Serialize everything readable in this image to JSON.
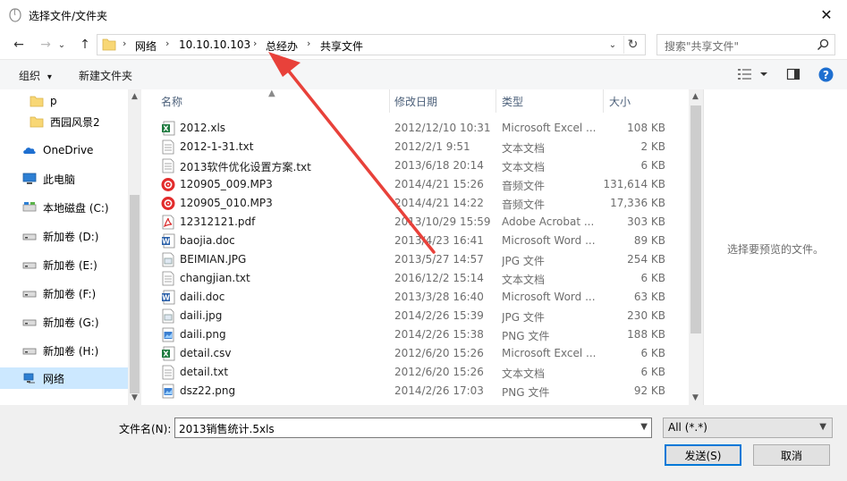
{
  "window": {
    "title": "选择文件/文件夹",
    "close_glyph": "✕"
  },
  "nav": {
    "back_glyph": "←",
    "forward_glyph": "→",
    "recent_glyph": "⌄",
    "up_glyph": "↑",
    "breadcrumbs": [
      "网络",
      "10.10.10.103",
      "总经办",
      "共享文件"
    ],
    "separator": "›",
    "refresh_glyph": "↻",
    "dropdown_glyph": "⌄"
  },
  "search": {
    "placeholder": "搜索\"共享文件\""
  },
  "toolbar": {
    "organize": "组织",
    "new_folder": "新建文件夹",
    "dropdown_glyph": "▾"
  },
  "sidebar": {
    "items": [
      {
        "label": "p",
        "icon": "folder-icon"
      },
      {
        "label": "西园风景2",
        "icon": "folder-icon"
      },
      {
        "label": "OneDrive",
        "icon": "cloud-icon"
      },
      {
        "label": "此电脑",
        "icon": "computer-icon"
      },
      {
        "label": "本地磁盘 (C:)",
        "icon": "drive-icon"
      },
      {
        "label": "新加卷 (D:)",
        "icon": "drive-icon"
      },
      {
        "label": "新加卷 (E:)",
        "icon": "drive-icon"
      },
      {
        "label": "新加卷 (F:)",
        "icon": "drive-icon"
      },
      {
        "label": "新加卷 (G:)",
        "icon": "drive-icon"
      },
      {
        "label": "新加卷 (H:)",
        "icon": "drive-icon"
      },
      {
        "label": "网络",
        "icon": "network-icon",
        "selected": true
      }
    ]
  },
  "columns": {
    "name": "名称",
    "date": "修改日期",
    "type": "类型",
    "size": "大小"
  },
  "files": [
    {
      "name": "2012.xls",
      "date": "2012/12/10 10:31",
      "type": "Microsoft Excel ...",
      "size": "108 KB",
      "icon": "excel-icon"
    },
    {
      "name": "2012-1-31.txt",
      "date": "2012/2/1 9:51",
      "type": "文本文档",
      "size": "2 KB",
      "icon": "text-file-icon"
    },
    {
      "name": "2013软件优化设置方案.txt",
      "date": "2013/6/18 20:14",
      "type": "文本文档",
      "size": "6 KB",
      "icon": "text-file-icon"
    },
    {
      "name": "120905_009.MP3",
      "date": "2014/4/21 15:26",
      "type": "音频文件",
      "size": "131,614 KB",
      "icon": "audio-icon"
    },
    {
      "name": "120905_010.MP3",
      "date": "2014/4/21 14:22",
      "type": "音频文件",
      "size": "17,336 KB",
      "icon": "audio-icon"
    },
    {
      "name": "12312121.pdf",
      "date": "2013/10/29 15:59",
      "type": "Adobe Acrobat ...",
      "size": "303 KB",
      "icon": "pdf-icon"
    },
    {
      "name": "baojia.doc",
      "date": "2013/4/23 16:41",
      "type": "Microsoft Word ...",
      "size": "89 KB",
      "icon": "word-icon"
    },
    {
      "name": "BEIMIAN.JPG",
      "date": "2013/5/27 14:57",
      "type": "JPG 文件",
      "size": "254 KB",
      "icon": "image-icon"
    },
    {
      "name": "changjian.txt",
      "date": "2016/12/2 15:14",
      "type": "文本文档",
      "size": "6 KB",
      "icon": "text-file-icon"
    },
    {
      "name": "daili.doc",
      "date": "2013/3/28 16:40",
      "type": "Microsoft Word ...",
      "size": "63 KB",
      "icon": "word-icon"
    },
    {
      "name": "daili.jpg",
      "date": "2014/2/26 15:39",
      "type": "JPG 文件",
      "size": "230 KB",
      "icon": "image-icon"
    },
    {
      "name": "daili.png",
      "date": "2014/2/26 15:38",
      "type": "PNG 文件",
      "size": "188 KB",
      "icon": "png-icon"
    },
    {
      "name": "detail.csv",
      "date": "2012/6/20 15:26",
      "type": "Microsoft Excel ...",
      "size": "6 KB",
      "icon": "excel-icon"
    },
    {
      "name": "detail.txt",
      "date": "2012/6/20 15:26",
      "type": "文本文档",
      "size": "6 KB",
      "icon": "text-file-icon"
    },
    {
      "name": "dsz22.png",
      "date": "2014/2/26 17:03",
      "type": "PNG 文件",
      "size": "92 KB",
      "icon": "png-icon"
    }
  ],
  "preview": {
    "empty_text": "选择要预览的文件。"
  },
  "footer": {
    "filename_label": "文件名(N):",
    "filename_value": "2013销售统计.5xls",
    "filter_value": "All (*.*)",
    "send_button": "发送(S)",
    "cancel_button": "取消"
  },
  "colors": {
    "selection": "#cce8ff",
    "accent": "#0078d7",
    "annotation_arrow": "#e8413a"
  }
}
